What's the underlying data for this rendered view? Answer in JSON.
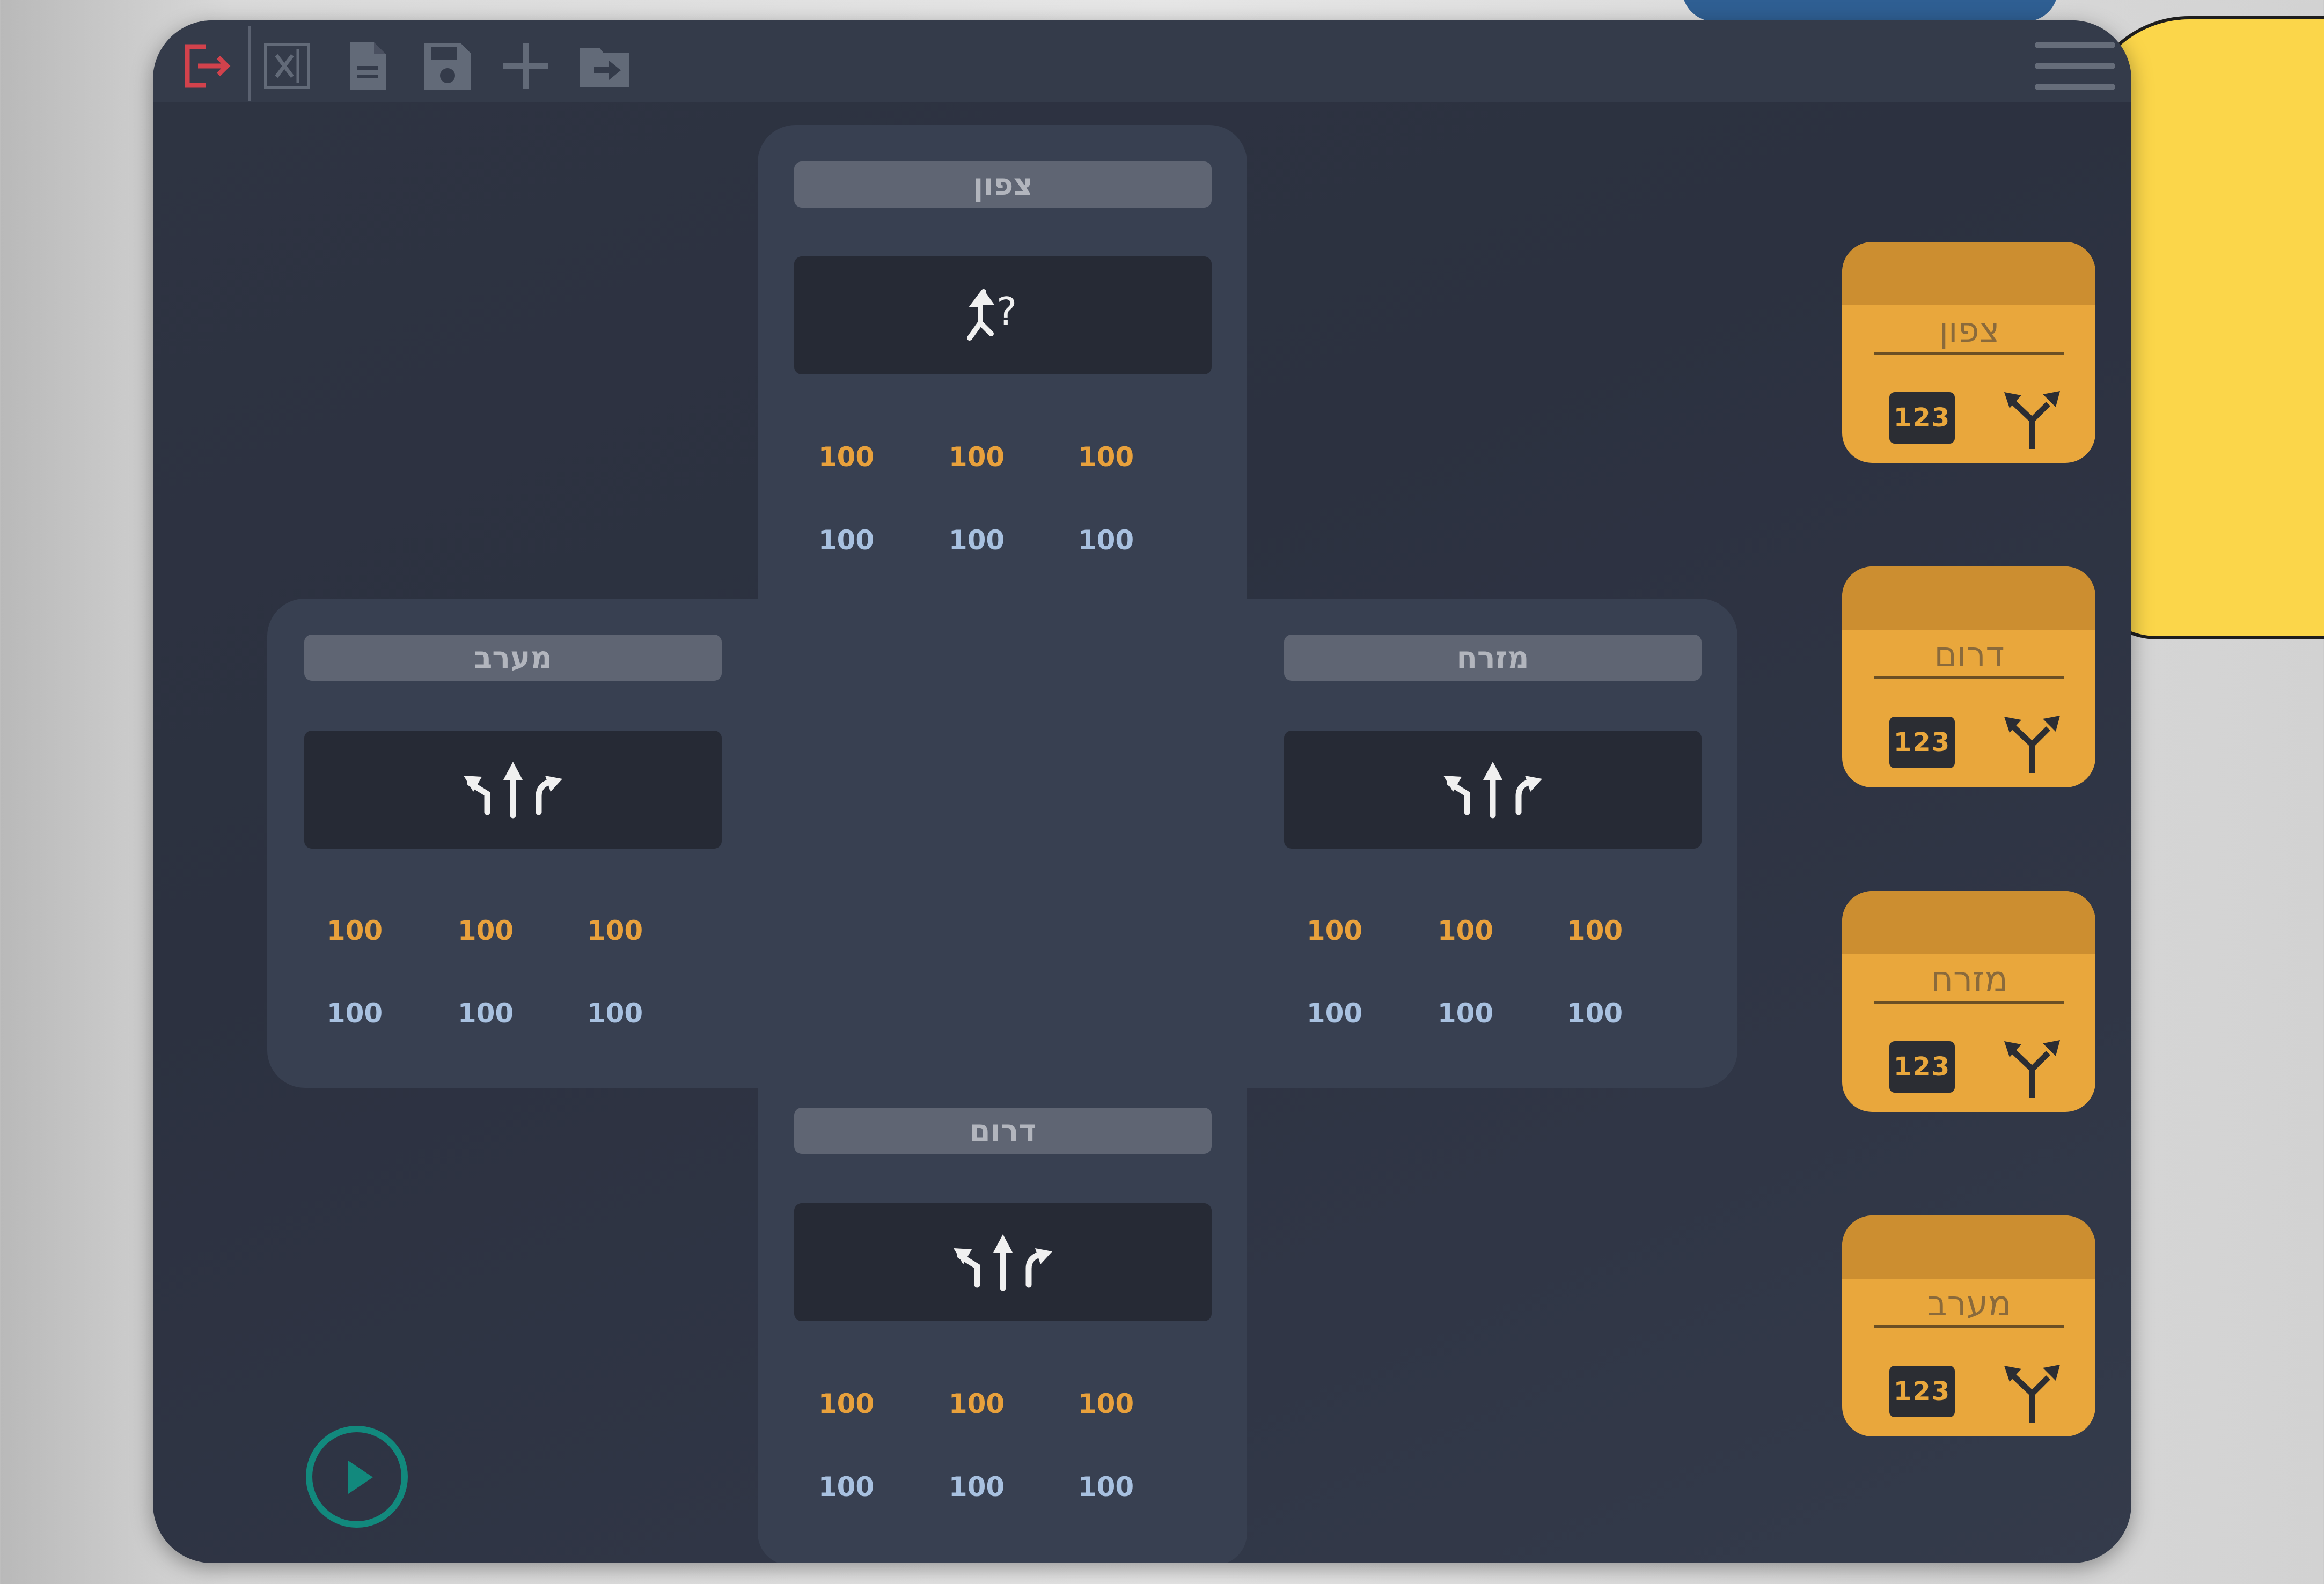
{
  "colors": {
    "accent_orange": "#e9a73c",
    "value_orange": "#e8a13c",
    "value_blue": "#a8c1e0",
    "exit_red": "#d2424c",
    "play_teal": "#12897d"
  },
  "toolbar": {
    "icons": [
      "exit-icon",
      "excel-icon",
      "document-icon",
      "save-icon",
      "add-icon",
      "export-icon",
      "menu-icon"
    ]
  },
  "approaches": {
    "north": {
      "label": "צפון",
      "lane_icon": "merge-question-icon",
      "orange": [
        "100",
        "100",
        "100"
      ],
      "blue": [
        "100",
        "100",
        "100"
      ]
    },
    "west": {
      "label": "מערב",
      "lane_icon": "left-straight-right-icon",
      "orange": [
        "100",
        "100",
        "100"
      ],
      "blue": [
        "100",
        "100",
        "100"
      ]
    },
    "east": {
      "label": "מזרח",
      "lane_icon": "left-straight-right-icon",
      "orange": [
        "100",
        "100",
        "100"
      ],
      "blue": [
        "100",
        "100",
        "100"
      ]
    },
    "south": {
      "label": "דרום",
      "lane_icon": "left-straight-right-icon",
      "orange": [
        "100",
        "100",
        "100"
      ],
      "blue": [
        "100",
        "100",
        "100"
      ]
    }
  },
  "cards": [
    {
      "title": "צפון",
      "badge": "123",
      "icon": "fork-icon"
    },
    {
      "title": "דרום",
      "badge": "123",
      "icon": "fork-icon"
    },
    {
      "title": "מזרח",
      "badge": "123",
      "icon": "fork-icon"
    },
    {
      "title": "מערב",
      "badge": "123",
      "icon": "fork-icon"
    }
  ],
  "play": {
    "icon": "play-icon"
  }
}
